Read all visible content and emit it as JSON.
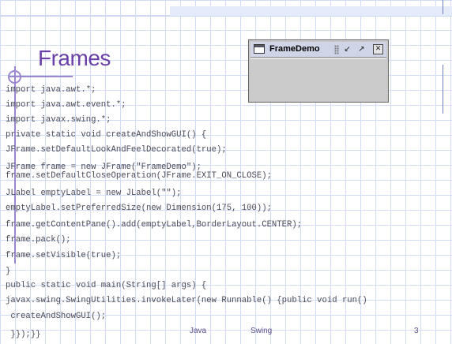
{
  "slide": {
    "title": "Frames",
    "code_lines": [
      "import java.awt.*;",
      "import java.awt.event.*;",
      "import javax.swing.*;",
      "private static void createAndShowGUI() {",
      "JFrame.setDefaultLookAndFeelDecorated(true);",
      "JFrame frame = new JFrame(\"FrameDemo\");",
      "frame.setDefaultCloseOperation(JFrame.EXIT_ON_CLOSE);",
      "JLabel emptyLabel = new JLabel(\"\");",
      "emptyLabel.setPreferredSize(new Dimension(175, 100));",
      "frame.getContentPane().add(emptyLabel,BorderLayout.CENTER);",
      "frame.pack();",
      "frame.setVisible(true);",
      "}",
      "public static void main(String[] args) {",
      "javax.swing.SwingUtilities.invokeLater(new Runnable() {public void run()",
      " createAndShowGUI();",
      " }});}}"
    ],
    "footer": {
      "left": "Java",
      "center": "Swing",
      "page_number": "3"
    }
  },
  "frame_demo": {
    "title": "FrameDemo",
    "icons": {
      "app": "window-icon",
      "minimize": "minimize-icon",
      "maximize": "maximize-icon",
      "close": "close-icon"
    }
  },
  "colors": {
    "title": "#6b3fa8",
    "accent_line": "#9a87cf",
    "grid": "#d2dcf4"
  }
}
